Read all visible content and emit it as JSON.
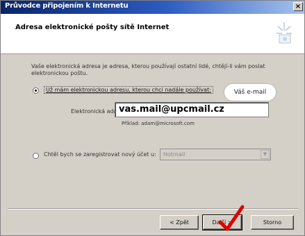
{
  "window": {
    "title": "Průvodce připojením k Internetu",
    "close_glyph": "×"
  },
  "header": {
    "title": "Adresa elektronické pošty sítě Internet"
  },
  "content": {
    "description": "Vaše elektronická adresa je adresa, kterou používají ostatní lidé, chtějí-li vám poslat elektronickou poštu.",
    "option_existing_label": "Už mám elektronickou adresu, kterou chci nadále používat:",
    "callout_text": "Váš e-mail",
    "email_field_label": "Elektronická adresa:",
    "email_value": "vas.mail@upcmail.cz",
    "example_text": "Příklad: adam@microsoft.com",
    "option_new_label": "Chtěl bych se zaregistrovat nový účet u:",
    "provider_select_value": "Hotmail",
    "provider_select_arrow": "▼"
  },
  "buttons": {
    "back": "< Zpět",
    "next": "Další >",
    "cancel": "Storno"
  },
  "colors": {
    "checkmark": "#e00000"
  }
}
